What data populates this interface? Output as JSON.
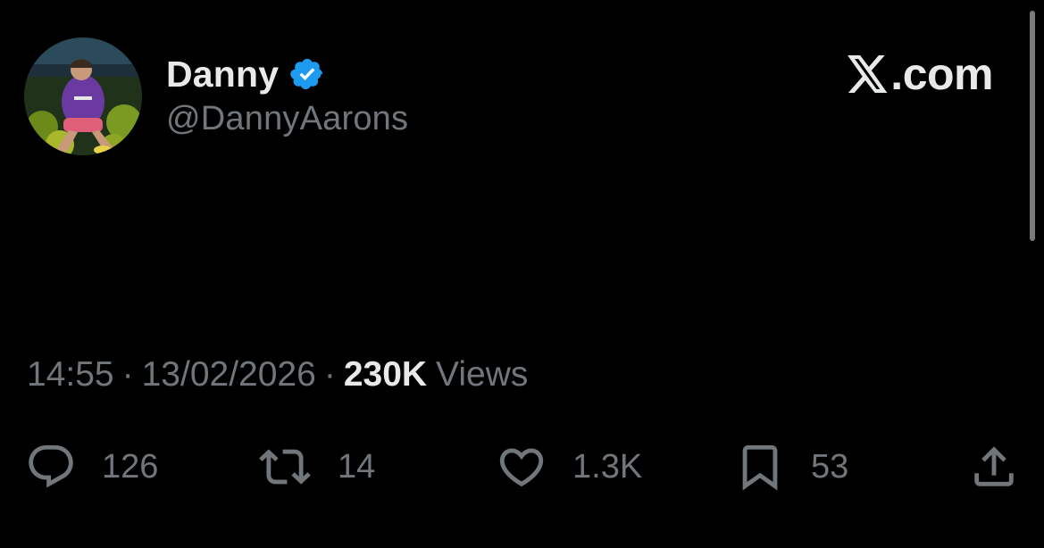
{
  "author": {
    "display_name": "Danny",
    "handle": "@DannyAarons",
    "verified": true
  },
  "brand": {
    "text": ".com"
  },
  "meta": {
    "time": "14:55",
    "separator": "·",
    "date": "13/02/2026",
    "views_count": "230K",
    "views_label": "Views"
  },
  "actions": {
    "replies": "126",
    "reposts": "14",
    "likes": "1.3K",
    "bookmarks": "53"
  },
  "colors": {
    "background": "#000000",
    "primary_text": "#e7e9ea",
    "secondary_text": "#71767b",
    "verified_badge": "#1d9bf0"
  },
  "icons": {
    "verified": "verified-badge-icon",
    "brand": "x-logo-icon",
    "reply": "reply-bubble-icon",
    "repost": "repost-icon",
    "like": "heart-icon",
    "bookmark": "bookmark-icon",
    "share": "share-icon"
  }
}
